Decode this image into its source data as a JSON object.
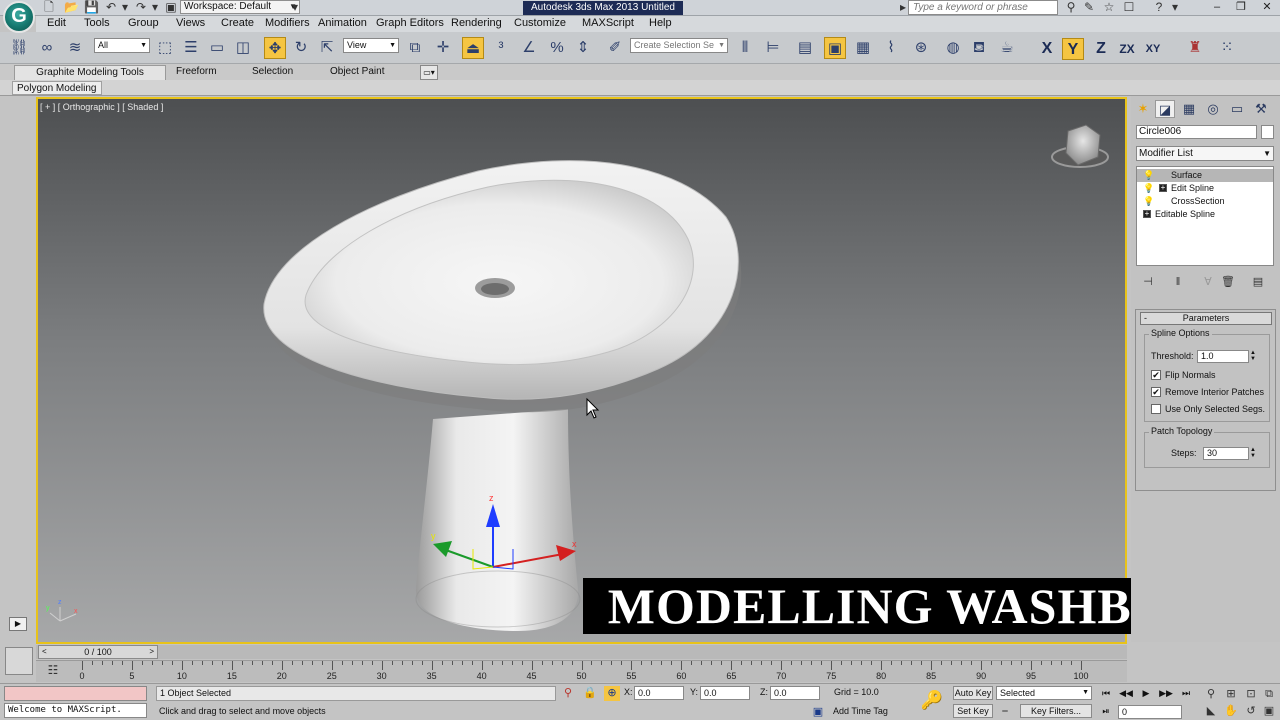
{
  "app": {
    "title": "Autodesk 3ds Max  2013     Untitled",
    "logo_letter": "G",
    "workspace_label": "Workspace: Default",
    "search_placeholder": "Type a keyword or phrase"
  },
  "menu": [
    "Edit",
    "Tools",
    "Group",
    "Views",
    "Create",
    "Modifiers",
    "Animation",
    "Graph Editors",
    "Rendering",
    "Customize",
    "MAXScript",
    "Help"
  ],
  "toolbar": {
    "selection_filter": "All",
    "reference_coord": "View",
    "named_selection_placeholder": "Create Selection Se",
    "axis_x": "X",
    "axis_y": "Y",
    "axis_z": "Z",
    "axis_zx": "ZX",
    "axis_xy": "XY"
  },
  "ribbon": {
    "tabs": [
      "Graphite Modeling Tools",
      "Freeform",
      "Selection",
      "Object Paint"
    ],
    "panel_button": "Polygon Modeling"
  },
  "viewport": {
    "label": "[ + ] [ Orthographic ] [ Shaded ]",
    "gizmo_x": "x",
    "gizmo_y": "y",
    "gizmo_z": "z"
  },
  "overlay_title": "MODELLING WASHBASIN",
  "command_panel": {
    "object_name": "Circle006",
    "modifier_list_label": "Modifier List",
    "stack": [
      {
        "label": "Surface",
        "selected": true,
        "expandable": false
      },
      {
        "label": "Edit Spline",
        "selected": false,
        "expandable": true
      },
      {
        "label": "CrossSection",
        "selected": false,
        "expandable": false
      },
      {
        "label": "Editable Spline",
        "selected": false,
        "expandable": true
      }
    ],
    "rollout_title": "Parameters",
    "spline_options": {
      "title": "Spline Options",
      "threshold_label": "Threshold:",
      "threshold_value": "1.0",
      "flip_normals_label": "Flip Normals",
      "flip_normals_checked": "✔",
      "remove_interior_label": "Remove Interior Patches",
      "remove_interior_checked": "✔",
      "use_only_selected_label": "Use Only Selected Segs.",
      "use_only_selected_checked": ""
    },
    "patch_topology": {
      "title": "Patch Topology",
      "steps_label": "Steps:",
      "steps_value": "30"
    }
  },
  "timeline": {
    "frame_display": "0 / 100",
    "ticks": [
      0,
      5,
      10,
      15,
      20,
      25,
      30,
      35,
      40,
      45,
      50,
      55,
      60,
      65,
      70,
      75,
      80,
      85,
      90,
      95,
      100
    ]
  },
  "status": {
    "maxscript_text": "Welcome to MAXScript.",
    "selection_text": "1 Object Selected",
    "prompt_text": "Click and drag to select and move objects",
    "x_label": "X:",
    "x_value": "0.0",
    "y_label": "Y:",
    "y_value": "0.0",
    "z_label": "Z:",
    "z_value": "0.0",
    "grid_text": "Grid = 10.0",
    "add_time_tag": "Add Time Tag",
    "auto_key": "Auto Key",
    "set_key": "Set Key",
    "selected_dropdown": "Selected",
    "key_filters": "Key Filters...",
    "current_frame": "0"
  },
  "colors": {
    "active_highlight": "#f5c542",
    "viewport_border": "#e8c31a",
    "maxscript_pink": "#f2c6c6"
  }
}
